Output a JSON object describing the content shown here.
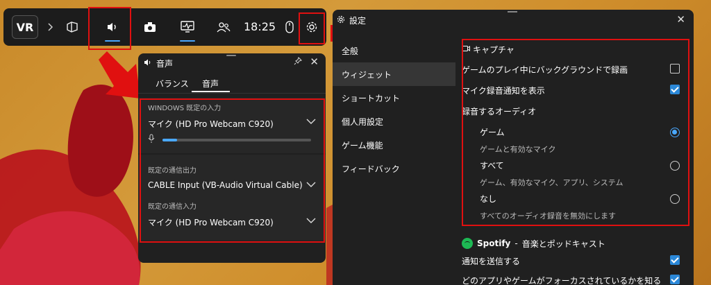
{
  "gamebar": {
    "logo": "VR",
    "time": "18:25",
    "icons": [
      "chevron-right-icon",
      "widget-icon",
      "volume-icon",
      "camera-icon",
      "performance-icon",
      "social-icon",
      "mouse-icon",
      "gear-icon"
    ]
  },
  "audio_panel": {
    "title": "音声",
    "tabs": [
      {
        "label": "バランス"
      },
      {
        "label": "音声"
      }
    ],
    "sections": [
      {
        "label": "WINDOWS 既定の入力",
        "value": "マイク (HD Pro Webcam C920)"
      },
      {
        "label": "既定の通信出力",
        "value": "CABLE Input (VB-Audio Virtual Cable)"
      },
      {
        "label": "既定の通信入力",
        "value": "マイク (HD Pro Webcam C920)"
      }
    ],
    "mic_level": 0.1
  },
  "settings": {
    "title": "設定",
    "nav": [
      {
        "label": "全般"
      },
      {
        "label": "ウィジェット"
      },
      {
        "label": "ショートカット"
      },
      {
        "label": "個人用設定"
      },
      {
        "label": "ゲーム機能"
      },
      {
        "label": "フィードバック"
      }
    ],
    "capture": {
      "heading": "キャプチャ",
      "bg_record": "ゲームのプレイ中にバックグラウンドで録画",
      "bg_record_checked": false,
      "mic_notify": "マイク録音通知を表示",
      "mic_notify_checked": true,
      "audio_label": "録音するオーディオ",
      "options": [
        {
          "title": "ゲーム",
          "desc": "ゲームと有効なマイク",
          "selected": true
        },
        {
          "title": "すべて",
          "desc": "ゲーム、有効なマイク、アプリ、システム",
          "selected": false
        },
        {
          "title": "なし",
          "desc": "すべてのオーディオ録音を無効にします",
          "selected": false
        }
      ]
    },
    "spotify": {
      "name": "Spotify",
      "sep": " - ",
      "tagline": "音楽とポッドキャスト",
      "notify": "通知を送信する",
      "notify_checked": true,
      "focus": "どのアプリやゲームがフォーカスされているかを知る",
      "focus_checked": true
    }
  },
  "colors": {
    "highlight_red": "#e01010",
    "accent_blue": "#4aa8ff",
    "spotify_green": "#1db954"
  }
}
